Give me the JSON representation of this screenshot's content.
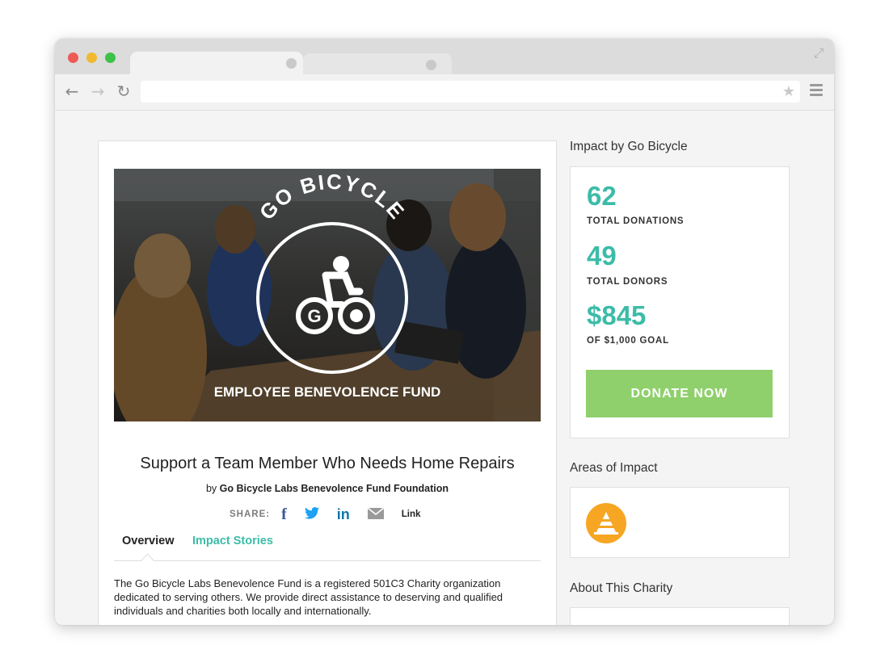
{
  "browser": {
    "colors": {
      "close": "#ee5b57",
      "minimize": "#f0b92f",
      "zoom": "#3cc248"
    },
    "icons": [
      "back-arrow-icon",
      "forward-arrow-icon",
      "reload-icon",
      "star-icon",
      "menu-icon",
      "expand-icon"
    ]
  },
  "hero": {
    "brand": "GO BICYCLE",
    "caption": "EMPLOYEE BENEVOLENCE FUND"
  },
  "campaign": {
    "title": "Support a Team Member Who Needs Home Repairs",
    "by_prefix": "by",
    "organizer": "Go Bicycle Labs Benevolence Fund Foundation",
    "share_label": "SHARE:",
    "share_link_label": "Link",
    "share_icons": [
      "facebook-icon",
      "twitter-icon",
      "linkedin-icon",
      "email-icon"
    ],
    "tabs": [
      "Overview",
      "Impact Stories"
    ],
    "description": "The Go Bicycle Labs Benevolence Fund is a registered 501C3 Charity organization dedicated to serving others. We provide direct assistance to deserving and qualified individuals and charities both locally and internationally."
  },
  "sidebar": {
    "impact_heading": "Impact by Go Bicycle",
    "stats": [
      {
        "value": "62",
        "label": "TOTAL DONATIONS"
      },
      {
        "value": "49",
        "label": "TOTAL DONORS"
      },
      {
        "value": "$845",
        "label": "OF $1,000 GOAL"
      }
    ],
    "donate_label": "DONATE NOW",
    "areas_heading": "Areas of Impact",
    "area_icon": "cone-icon",
    "about_heading": "About This Charity"
  },
  "colors": {
    "accent": "#3cbca8",
    "donate": "#8fd06c",
    "area_icon": "#f6a623"
  }
}
